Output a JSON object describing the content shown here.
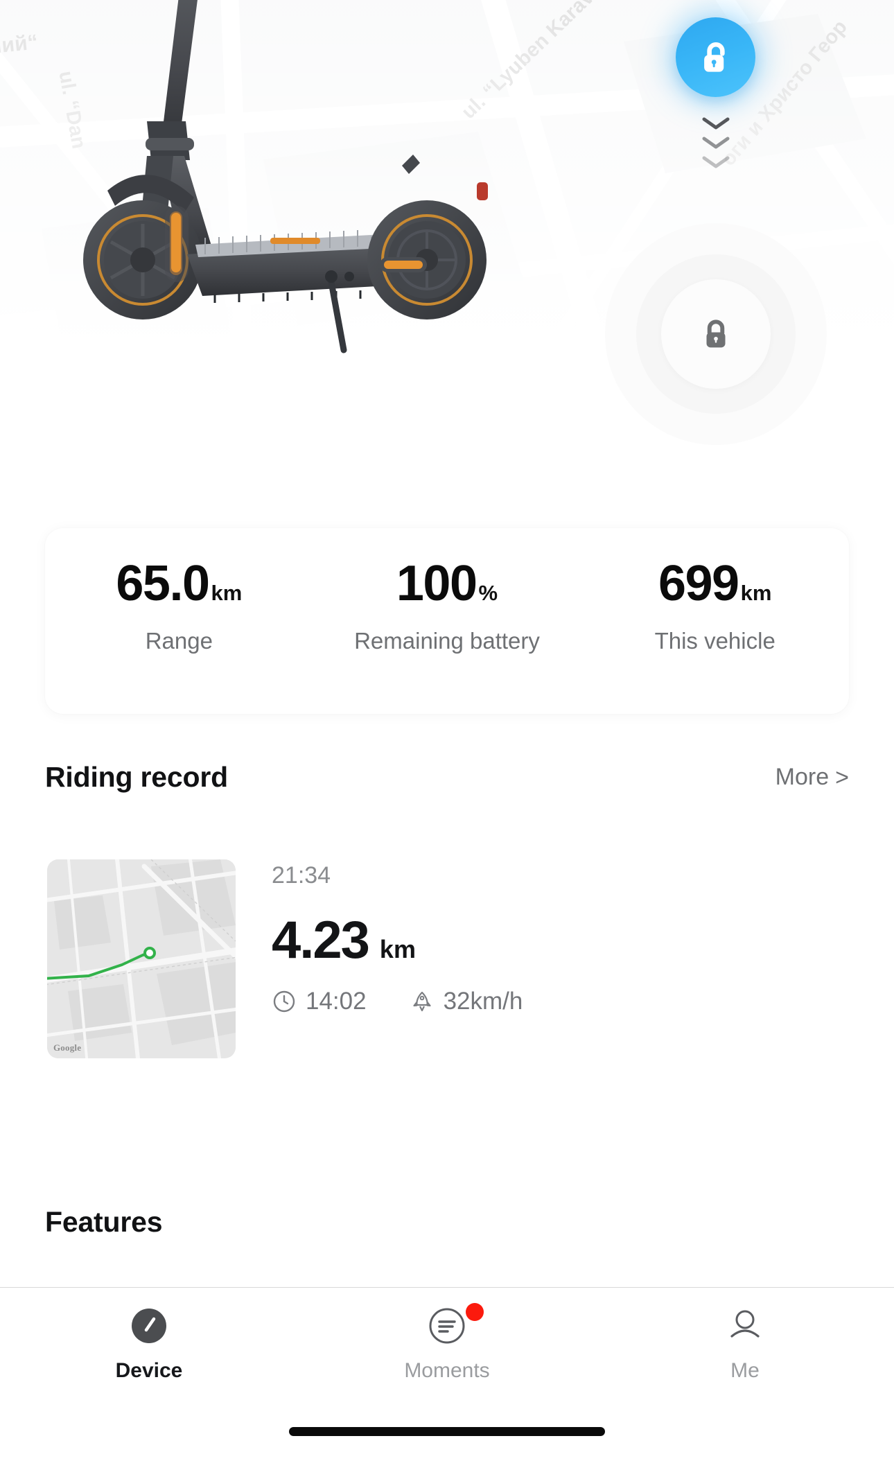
{
  "app": {
    "background_color": "#ffffff",
    "accent_color": "#3cb7f7"
  },
  "hero": {
    "map_labels": [
      {
        "text": "мий“"
      },
      {
        "text": "ul. “Dan"
      },
      {
        "text": "ul. “Lyuben Karave"
      },
      {
        "text": "оги и Христо Геор"
      }
    ],
    "unlock_button": {
      "icon": "unlock-icon",
      "color": "#3cb7f7"
    },
    "chevrons_icon": "chevron-down-icon",
    "lock_button": {
      "icon": "lock-icon",
      "color": "#6f7173"
    },
    "vehicle_image": "scooter-illustration"
  },
  "stats": {
    "items": [
      {
        "value": "65.0",
        "unit": "km",
        "label": "Range"
      },
      {
        "value": "100",
        "unit": "%",
        "label": "Remaining battery"
      },
      {
        "value": "699",
        "unit": "km",
        "label": "This vehicle"
      }
    ]
  },
  "riding_record": {
    "title": "Riding record",
    "more_label": "More",
    "more_chevron": ">",
    "entry": {
      "time": "21:34",
      "distance": "4.23",
      "distance_unit": "km",
      "duration_icon": "clock-icon",
      "duration": "14:02",
      "speed_icon": "rocket-icon",
      "speed": "32km/h",
      "map_watermark": "Google",
      "route_color": "#32b24a"
    }
  },
  "features": {
    "title": "Features"
  },
  "tabbar": {
    "items": [
      {
        "label": "Device",
        "icon": "speedometer-icon",
        "active": true,
        "badge": false
      },
      {
        "label": "Moments",
        "icon": "feed-icon",
        "active": false,
        "badge": true
      },
      {
        "label": "Me",
        "icon": "person-icon",
        "active": false,
        "badge": false
      }
    ],
    "badge_color": "#fb1a0d"
  }
}
